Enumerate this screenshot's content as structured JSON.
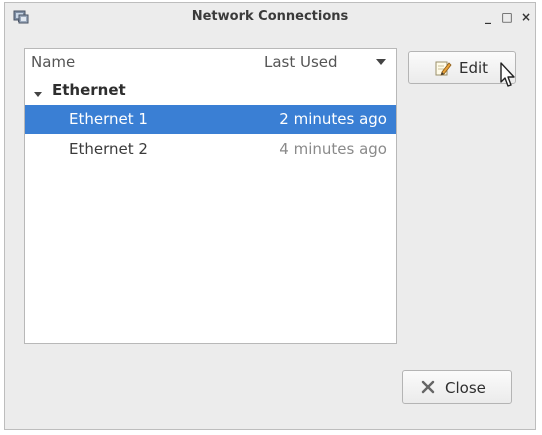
{
  "window": {
    "title": "Network Connections",
    "controls": {
      "minimize": "_",
      "maximize": "□",
      "close": "×"
    }
  },
  "list": {
    "columns": {
      "name": "Name",
      "last_used": "Last Used"
    },
    "sort_icon": "sort-descending-icon",
    "groups": [
      {
        "label": "Ethernet",
        "expanded": true,
        "connections": [
          {
            "name": "Ethernet 1",
            "last_used": "2 minutes ago",
            "selected": true
          },
          {
            "name": "Ethernet 2",
            "last_used": "4 minutes ago",
            "selected": false
          }
        ]
      }
    ]
  },
  "buttons": {
    "edit": {
      "label": "Edit",
      "icon": "pencil-edit-icon"
    },
    "close": {
      "label": "Close",
      "icon": "close-x-icon"
    }
  },
  "colors": {
    "selection": "#3a7fd4",
    "window_bg": "#ececec",
    "list_bg": "#ffffff"
  }
}
